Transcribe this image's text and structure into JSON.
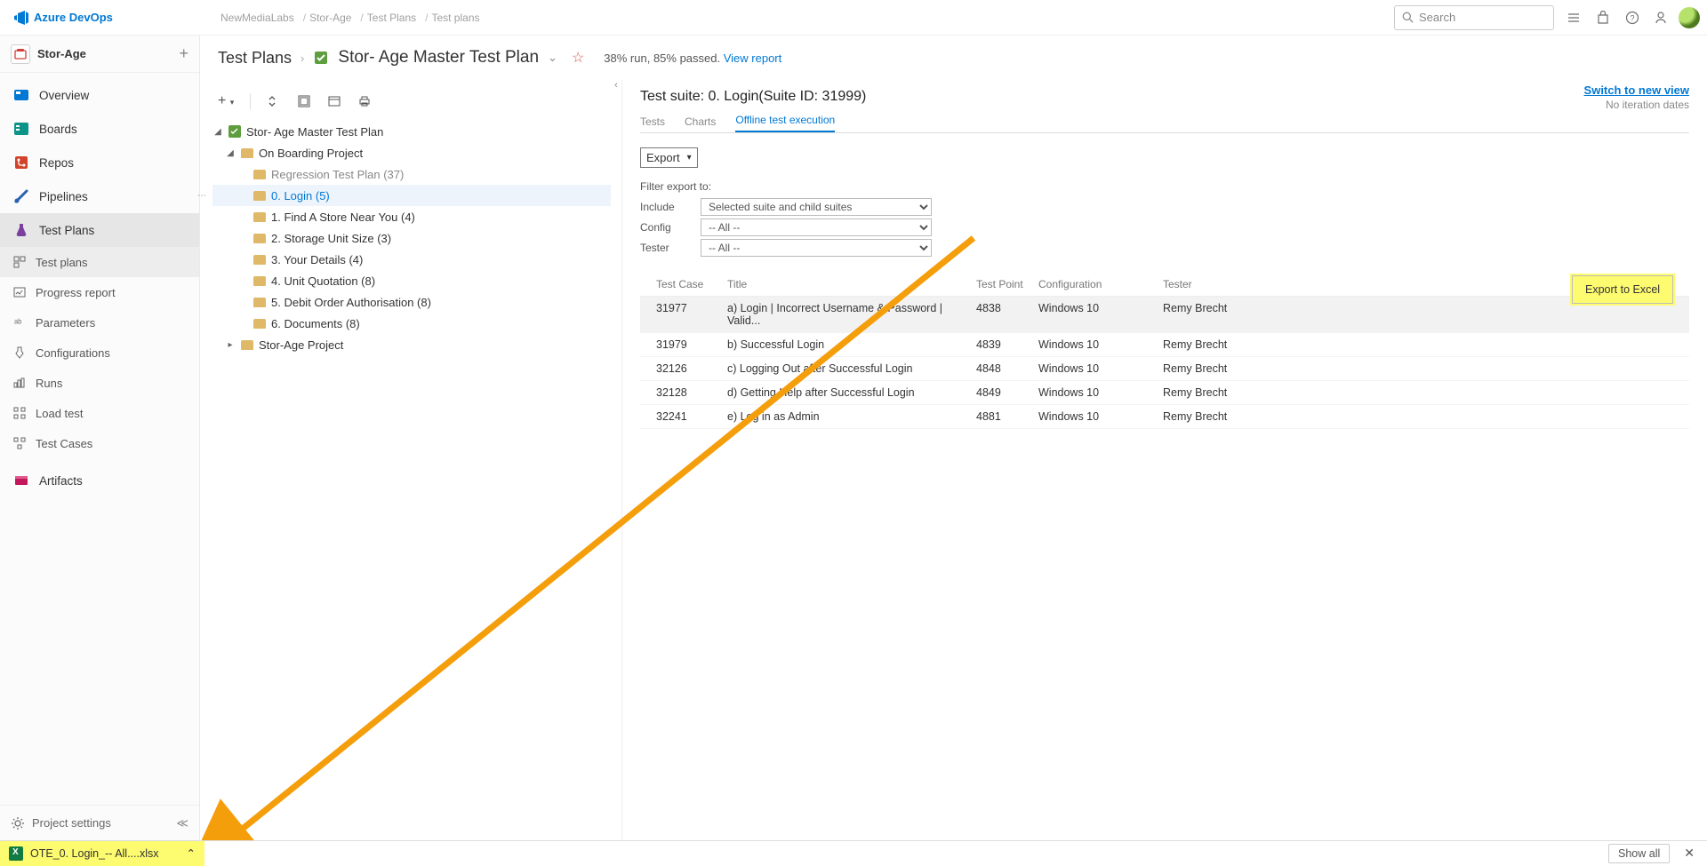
{
  "header": {
    "product": "Azure DevOps",
    "breadcrumbs": [
      "NewMediaLabs",
      "Stor-Age",
      "Test Plans",
      "Test plans"
    ],
    "search_placeholder": "Search"
  },
  "leftnav": {
    "project": "Stor-Age",
    "items": [
      {
        "label": "Overview"
      },
      {
        "label": "Boards"
      },
      {
        "label": "Repos"
      },
      {
        "label": "Pipelines"
      },
      {
        "label": "Test Plans"
      }
    ],
    "sub_items": [
      {
        "label": "Test plans"
      },
      {
        "label": "Progress report"
      },
      {
        "label": "Parameters"
      },
      {
        "label": "Configurations"
      },
      {
        "label": "Runs"
      },
      {
        "label": "Load test"
      },
      {
        "label": "Test Cases"
      }
    ],
    "artifacts": "Artifacts",
    "settings": "Project settings"
  },
  "title": {
    "section": "Test Plans",
    "plan": "Stor- Age Master Test Plan",
    "run_summary": "38% run, 85% passed.",
    "view_report": "View report"
  },
  "tree": {
    "root": "Stor- Age Master Test Plan",
    "onboarding": "On Boarding Project",
    "regression": "Regression Test Plan (37)",
    "login": "0. Login (5)",
    "find": "1. Find A Store Near You (4)",
    "storage": "2. Storage Unit Size (3)",
    "details": "3. Your Details (4)",
    "unit": "4. Unit Quotation (8)",
    "debit": "5. Debit Order Authorisation (8)",
    "docs": "6. Documents (8)",
    "storage_proj": "Stor-Age Project"
  },
  "detail": {
    "suite_title": "Test suite: 0. Login(Suite ID: 31999)",
    "tabs": [
      "Tests",
      "Charts",
      "Offline test execution"
    ],
    "switch_link": "Switch to new view",
    "no_iter": "No iteration dates",
    "export_label": "Export",
    "filter_label": "Filter export to:",
    "filters": {
      "include_label": "Include",
      "include_value": "Selected suite and child suites",
      "config_label": "Config",
      "config_value": "-- All --",
      "tester_label": "Tester",
      "tester_value": "-- All --"
    },
    "export_btn": "Export to Excel",
    "columns": [
      "Test Case",
      "Title",
      "Test Point",
      "Configuration",
      "Tester"
    ],
    "rows": [
      {
        "tc": "31977",
        "title": "a) Login | Incorrect Username & Password | Valid...",
        "tp": "4838",
        "cfg": "Windows 10",
        "tester": "Remy Brecht"
      },
      {
        "tc": "31979",
        "title": "b) Successful Login",
        "tp": "4839",
        "cfg": "Windows 10",
        "tester": "Remy Brecht"
      },
      {
        "tc": "32126",
        "title": "c) Logging Out after Successful Login",
        "tp": "4848",
        "cfg": "Windows 10",
        "tester": "Remy Brecht"
      },
      {
        "tc": "32128",
        "title": "d) Getting Help after Successful Login",
        "tp": "4849",
        "cfg": "Windows 10",
        "tester": "Remy Brecht"
      },
      {
        "tc": "32241",
        "title": "e) Log in as Admin",
        "tp": "4881",
        "cfg": "Windows 10",
        "tester": "Remy Brecht"
      }
    ]
  },
  "download": {
    "filename": "OTE_0. Login_-- All....xlsx",
    "show_all": "Show all"
  }
}
